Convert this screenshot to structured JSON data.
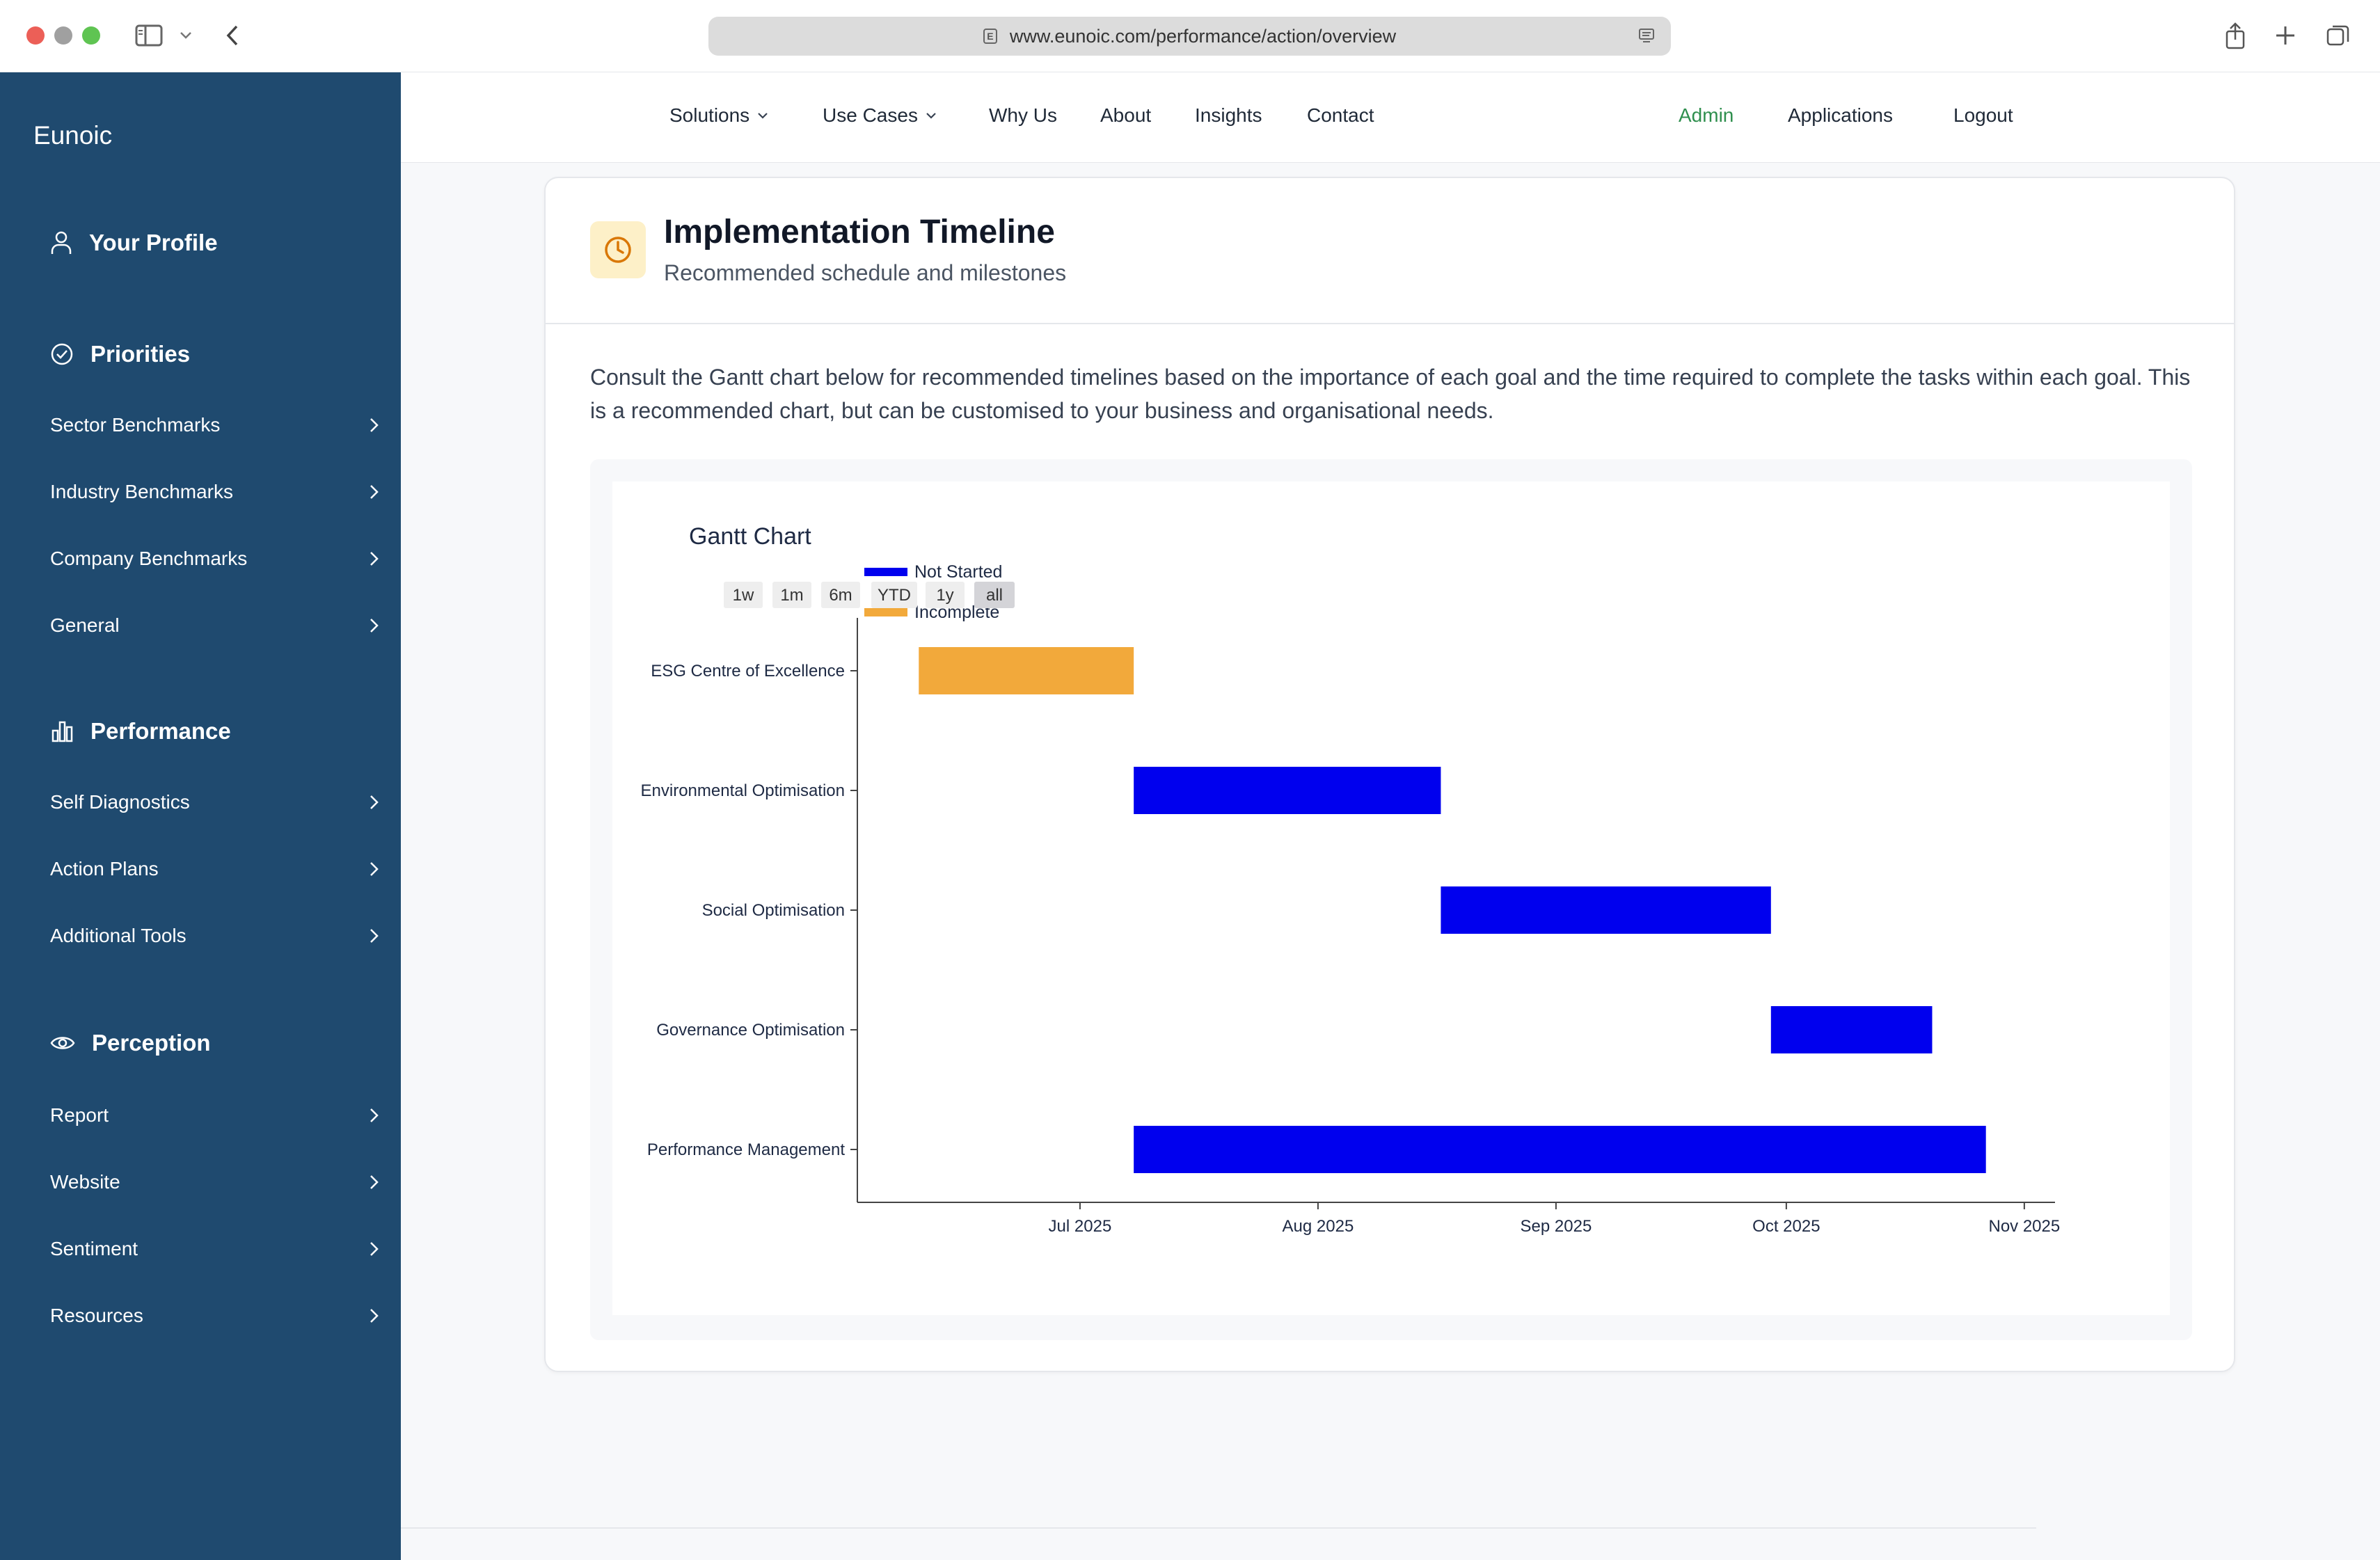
{
  "browser": {
    "url": "www.eunoic.com/performance/action/overview",
    "favicon_letter": "E"
  },
  "sidebar": {
    "brand": "Eunoic",
    "profile": "Your Profile",
    "priorities": {
      "title": "Priorities",
      "items": [
        "Sector Benchmarks",
        "Industry Benchmarks",
        "Company Benchmarks",
        "General"
      ]
    },
    "performance": {
      "title": "Performance",
      "items": [
        "Self Diagnostics",
        "Action Plans",
        "Additional Tools"
      ]
    },
    "perception": {
      "title": "Perception",
      "items": [
        "Report",
        "Website",
        "Sentiment",
        "Resources"
      ]
    }
  },
  "topnav": {
    "links": [
      "Solutions",
      "Use Cases",
      "Why Us",
      "About",
      "Insights",
      "Contact"
    ],
    "admin": "Admin",
    "applications": "Applications",
    "logout": "Logout"
  },
  "card": {
    "title": "Implementation Timeline",
    "subtitle": "Recommended schedule and milestones",
    "description": "Consult the Gantt chart below for recommended timelines based on the importance of each goal and the time required to complete the tasks within each goal. This is a recommended chart, but can be customised to your business and organisational needs."
  },
  "chart_data": {
    "type": "gantt",
    "title": "Gantt Chart",
    "range_buttons": [
      "1w",
      "1m",
      "6m",
      "YTD",
      "1y",
      "all"
    ],
    "active_range": "all",
    "legend": [
      {
        "name": "Not Started",
        "color": "#0000ee"
      },
      {
        "name": "Incomplete",
        "color": "#f2a93b"
      }
    ],
    "x_ticks": [
      "Jul 2025",
      "Aug 2025",
      "Sep 2025",
      "Oct 2025",
      "Nov 2025"
    ],
    "x_tick_dates": [
      "2025-07-01",
      "2025-08-01",
      "2025-09-01",
      "2025-10-01",
      "2025-11-01"
    ],
    "tasks": [
      {
        "name": "ESG Centre of Excellence",
        "start": "2025-06-10",
        "end": "2025-07-08",
        "status": "Incomplete"
      },
      {
        "name": "Environmental Optimisation",
        "start": "2025-07-08",
        "end": "2025-08-17",
        "status": "Not Started"
      },
      {
        "name": "Social Optimisation",
        "start": "2025-08-17",
        "end": "2025-09-29",
        "status": "Not Started"
      },
      {
        "name": "Governance Optimisation",
        "start": "2025-09-29",
        "end": "2025-10-20",
        "status": "Not Started"
      },
      {
        "name": "Performance Management",
        "start": "2025-07-08",
        "end": "2025-10-27",
        "status": "Not Started"
      }
    ],
    "xlim": [
      "2025-06-02",
      "2025-11-05"
    ]
  }
}
